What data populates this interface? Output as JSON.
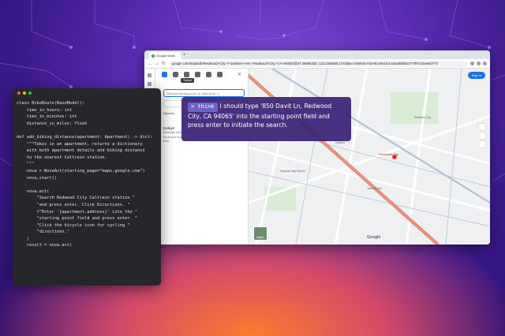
{
  "browser": {
    "tab_title": "Google Maps",
    "url": "google.com/maps/dir/Redwood+City,+/+Jasmine+Ave,+Redwood+City,+CA+94063/@37.48685333,-122.2345638,17z/data=!4m8!4m7!1m0!1m5!1m1!1s0x808fa2477f973:0xaeeb77d"
  },
  "maps": {
    "tooltip": "Transit",
    "start_placeholder": "Choose starting point, or click on th",
    "options_label": "Options",
    "delays_title": "Delays",
    "delays_subtitle": "Moderate traffic in this area",
    "delays_note": "No known road disruptions. Traffic incidents will show up here.",
    "signin_label": "Sign in",
    "layers_label": "Layers",
    "logo": "Google",
    "destination_label": "Redwood City",
    "labels": {
      "label_1": "Sequoia High School",
      "label_2": "Redwood City",
      "label_3": "Jasmine Ave",
      "label_4": "Caltrain"
    }
  },
  "code": {
    "lines": [
      "class BikeRoute(BaseModel):",
      "    time_in_hours: int",
      "    time_in_minutes: int",
      "    distance_in_miles: float",
      "",
      "def add_biking_distance(apartment: Apartment) -> dict:",
      "    \"\"\"Takes in an apartment, returns a dictionary",
      "    with both apartment details and biking distance",
      "    to the nearest Caltrain station.",
      "    \"\"\"",
      "    nova = NovaAct(starting_page=\"maps.google.com\")",
      "    nova.start()",
      "",
      "    nova.act(",
      "        \"Search Redwood City Caltrain station \"",
      "        \"and press enter. Click Directions. \"",
      "        f\"Enter '{apartment.address}' into the \"",
      "        \"starting point field and press enter. \"",
      "        \"Click the bicycle icon for cycling \"",
      "        \"directions.\"",
      "    )",
      "    result = nova.act("
    ]
  },
  "think": {
    "tag": "> think",
    "text": "I should type '850 Davit Ln, Redwood City, CA 94065' into the starting point field and press enter to initiate the search."
  },
  "colors": {
    "accent": "#1a73e8",
    "think_bg": "#3e2478",
    "code_bg": "#26272b"
  }
}
